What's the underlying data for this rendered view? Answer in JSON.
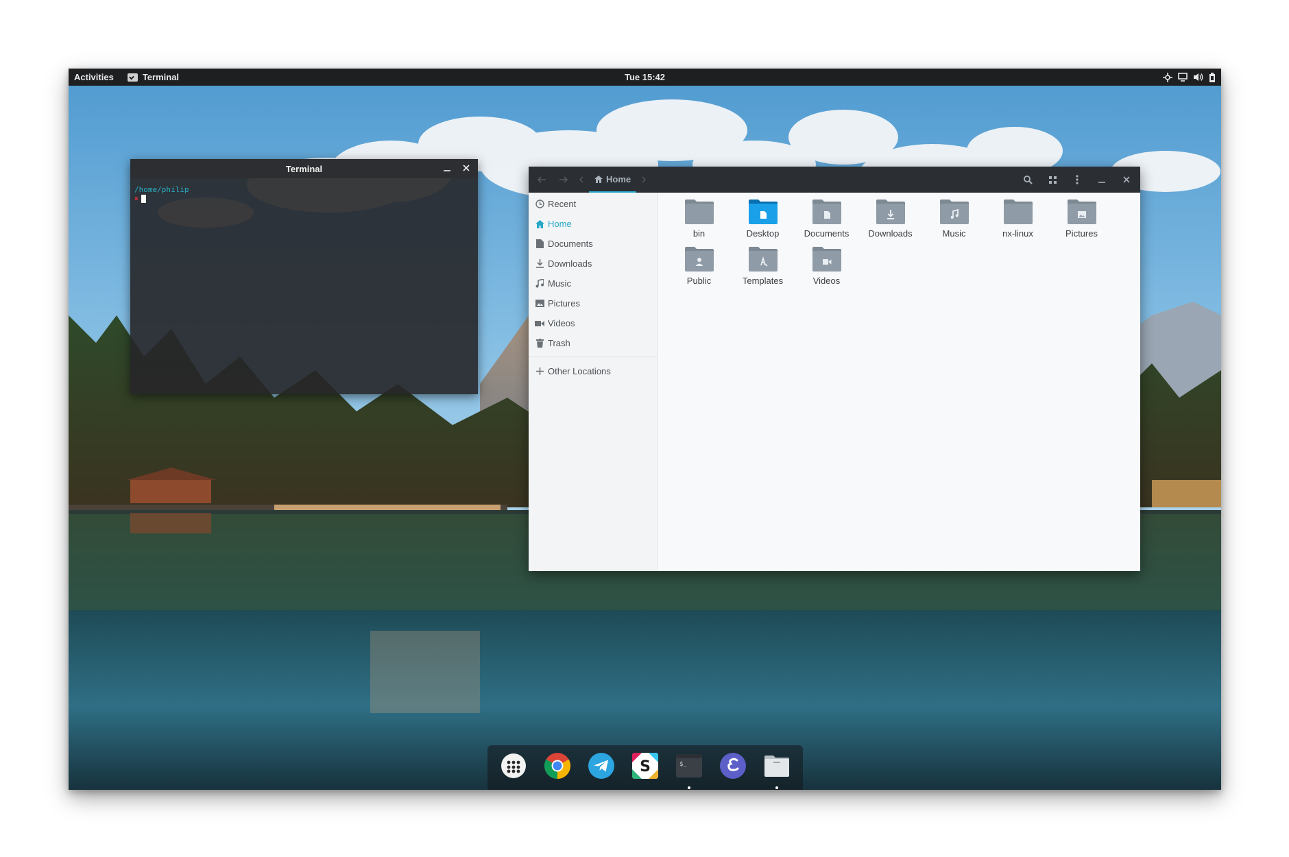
{
  "topbar": {
    "activities": "Activities",
    "app_name": "Terminal",
    "clock": "Tue 15:42",
    "tray_icons": [
      "network-icon",
      "display-icon",
      "volume-icon",
      "battery-icon"
    ]
  },
  "terminal": {
    "title": "Terminal",
    "path": "/home/philip"
  },
  "files": {
    "breadcrumb_home": "Home",
    "sidebar": [
      {
        "label": "Recent",
        "icon": "clock-icon"
      },
      {
        "label": "Home",
        "icon": "home-icon",
        "active": true
      },
      {
        "label": "Documents",
        "icon": "document-icon"
      },
      {
        "label": "Downloads",
        "icon": "download-icon"
      },
      {
        "label": "Music",
        "icon": "music-icon"
      },
      {
        "label": "Pictures",
        "icon": "picture-icon"
      },
      {
        "label": "Videos",
        "icon": "video-icon"
      },
      {
        "label": "Trash",
        "icon": "trash-icon"
      }
    ],
    "other_locations": "Other Locations",
    "folders": [
      {
        "label": "bin",
        "emblem": "none"
      },
      {
        "label": "Desktop",
        "emblem": "desktop"
      },
      {
        "label": "Documents",
        "emblem": "document"
      },
      {
        "label": "Downloads",
        "emblem": "download"
      },
      {
        "label": "Music",
        "emblem": "music"
      },
      {
        "label": "nx-linux",
        "emblem": "none"
      },
      {
        "label": "Pictures",
        "emblem": "picture"
      },
      {
        "label": "Public",
        "emblem": "user"
      },
      {
        "label": "Templates",
        "emblem": "template"
      },
      {
        "label": "Videos",
        "emblem": "video"
      }
    ]
  },
  "dock": {
    "apps": [
      {
        "name": "app-grid",
        "running": false
      },
      {
        "name": "chrome",
        "running": false
      },
      {
        "name": "telegram",
        "running": false
      },
      {
        "name": "slack",
        "running": false
      },
      {
        "name": "terminal",
        "running": true
      },
      {
        "name": "epichrome",
        "running": false
      },
      {
        "name": "files",
        "running": true
      }
    ]
  },
  "colors": {
    "accent": "#26a7c7",
    "topbar": "#1e1f21",
    "folder": "#8f9ba6",
    "desktop_folder": "#1aa0e8"
  }
}
